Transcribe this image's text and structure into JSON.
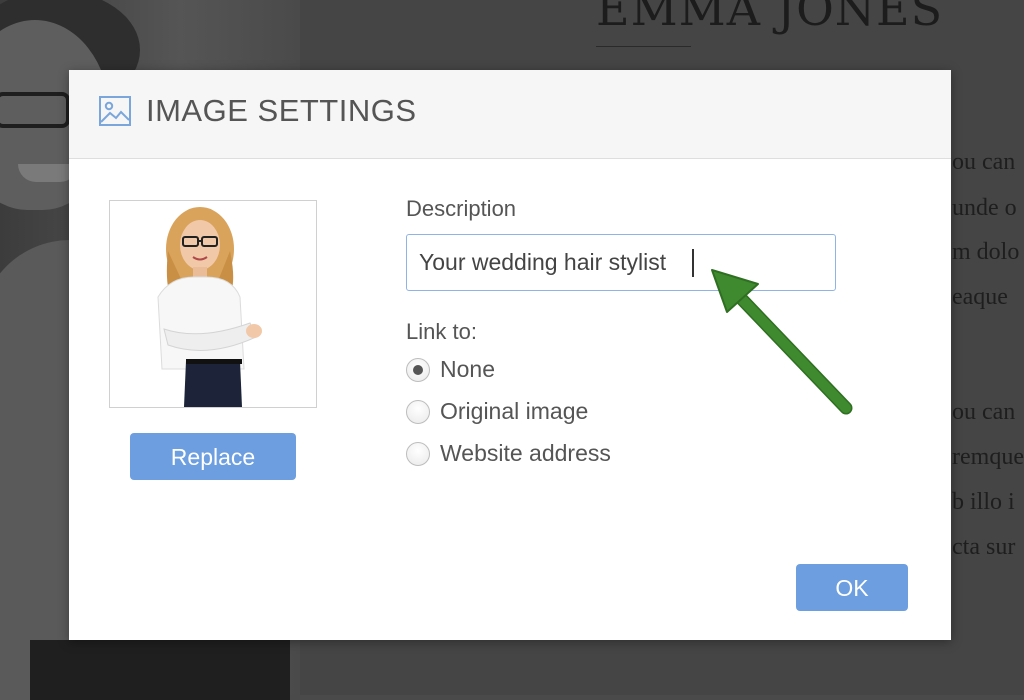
{
  "background": {
    "name": "EMMA JONES",
    "text_fragments": [
      "ou can",
      "unde o",
      "m dolo",
      "eaque",
      "ou can",
      "remque",
      "b illo i",
      "cta sur"
    ]
  },
  "dialog": {
    "title": "IMAGE SETTINGS",
    "header_icon": "image-icon",
    "replace_label": "Replace",
    "description": {
      "label": "Description",
      "value": "Your wedding hair stylist"
    },
    "link_to": {
      "label": "Link to:",
      "options": [
        {
          "label": "None",
          "selected": true
        },
        {
          "label": "Original image",
          "selected": false
        },
        {
          "label": "Website address",
          "selected": false
        }
      ]
    },
    "ok_label": "OK"
  },
  "colors": {
    "accent": "#6d9ee0",
    "arrow": "#3f8a2e",
    "overlay": "#454545"
  }
}
